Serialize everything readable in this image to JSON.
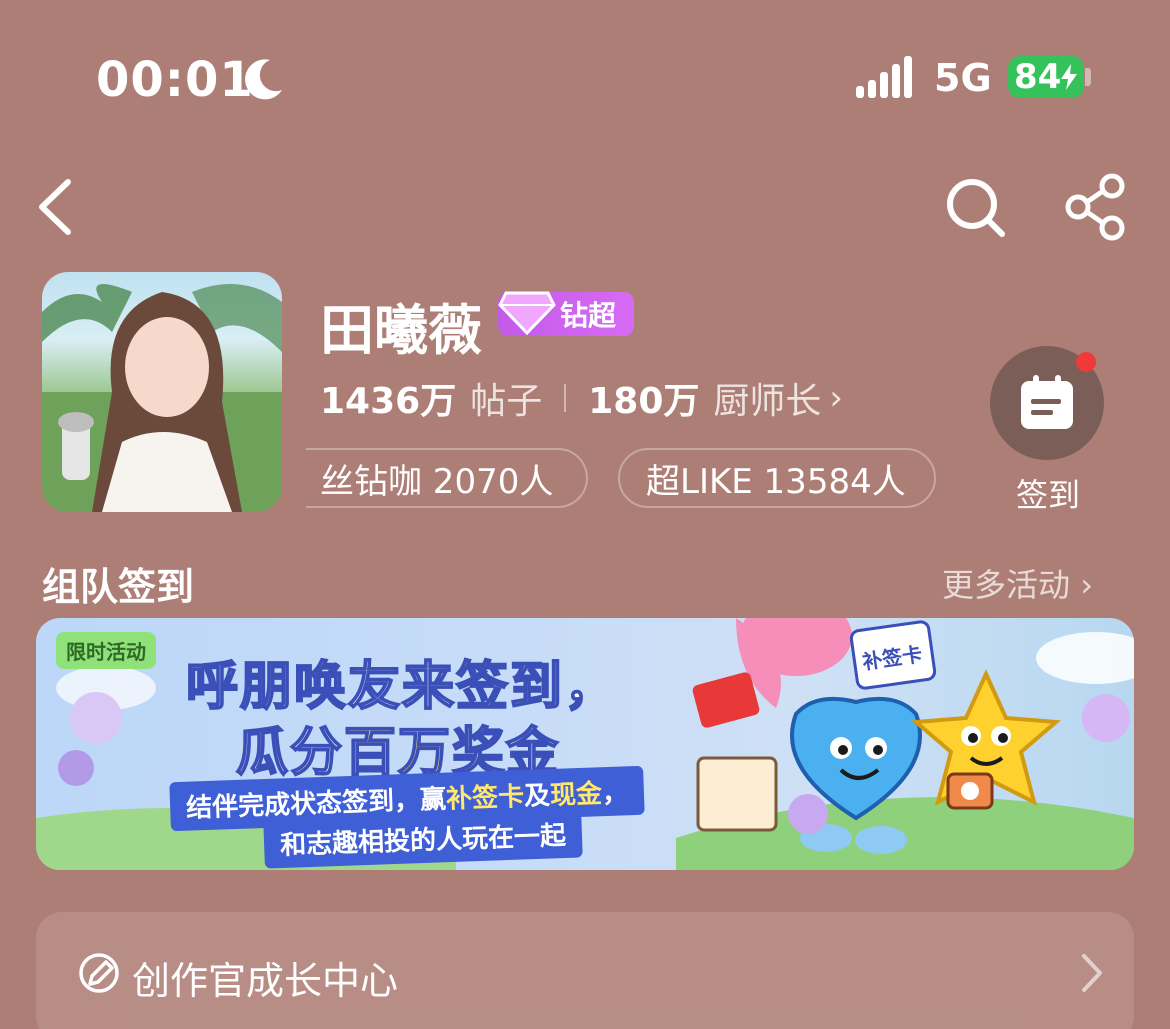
{
  "status_bar": {
    "time": "00:01",
    "network": "5G",
    "battery": "84"
  },
  "nav": {
    "back_icon": "chevron-left-icon",
    "search_icon": "search-icon",
    "share_icon": "share-icon"
  },
  "profile": {
    "name": "田曦薇",
    "badge_level": "1",
    "badge_label": "钻超",
    "posts_count": "1436万",
    "posts_label": "帖子",
    "members_count": "180万",
    "members_label": "厨师长",
    "fan_pill": "丝钻咖 2070人",
    "like_pill": "超LIKE 13584人",
    "sign_in_label": "签到"
  },
  "section": {
    "title": "组队签到",
    "more": "更多活动"
  },
  "banner": {
    "tag": "限时活动",
    "line1_a": "呼朋唤友来",
    "line1_hl": "签到",
    "line1_b": "，",
    "line2_a": "瓜分",
    "line2_hl": "百万",
    "line2_b": "奖金",
    "sub1_a": "结伴完成状态签到，赢",
    "sub1_hl1": "补签卡",
    "sub1_b": "及",
    "sub1_hl2": "现金",
    "sub1_c": "，",
    "sub2": "和志趣相投的人玩在一起",
    "card_label": "补签卡"
  },
  "creator": {
    "label": "创作官成长中心"
  },
  "colors": {
    "background": "#ad7e75",
    "battery": "#36c25a",
    "badge": "#c25ae8",
    "notification_dot": "#f03a3a"
  }
}
